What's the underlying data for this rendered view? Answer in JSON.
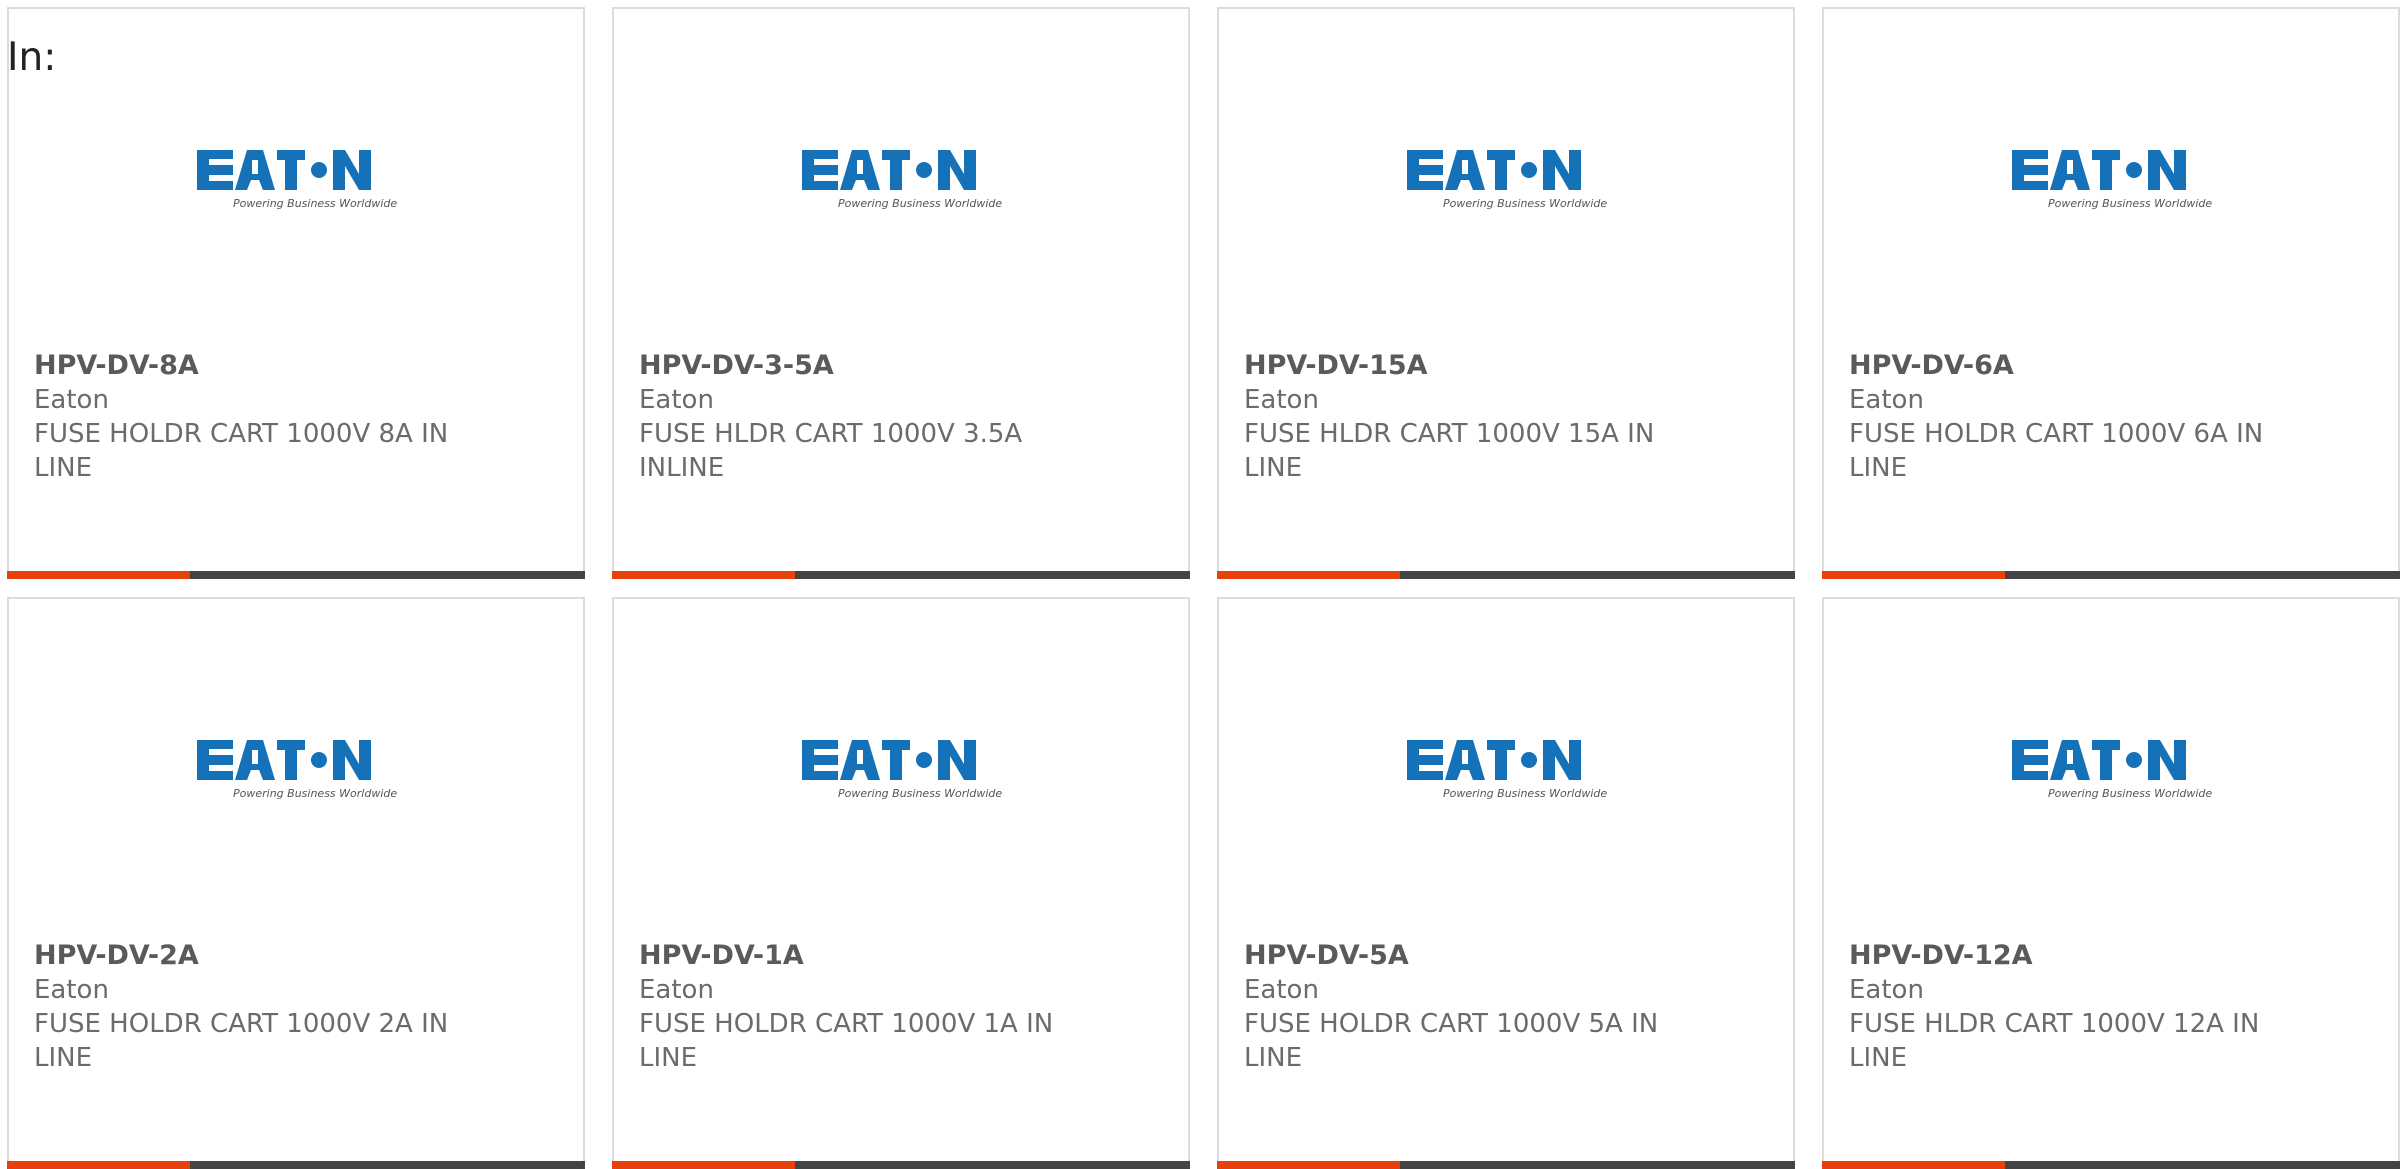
{
  "heading": "In:",
  "colors": {
    "accent": "#e8400c",
    "bar": "#444444",
    "brand_blue": "#1572b8",
    "text": "#6b6b6b"
  },
  "products": [
    {
      "part_number": "HPV-DV-8A",
      "manufacturer": "Eaton",
      "description": "FUSE HOLDR CART 1000V 8A IN LINE",
      "logo_text": "EATON",
      "logo_tagline": "Powering Business Worldwide"
    },
    {
      "part_number": "HPV-DV-3-5A",
      "manufacturer": "Eaton",
      "description": "FUSE HLDR CART 1000V 3.5A INLINE",
      "logo_text": "EATON",
      "logo_tagline": "Powering Business Worldwide"
    },
    {
      "part_number": "HPV-DV-15A",
      "manufacturer": "Eaton",
      "description": "FUSE HLDR CART 1000V 15A IN LINE",
      "logo_text": "EATON",
      "logo_tagline": "Powering Business Worldwide"
    },
    {
      "part_number": "HPV-DV-6A",
      "manufacturer": "Eaton",
      "description": "FUSE HOLDR CART 1000V 6A IN LINE",
      "logo_text": "EATON",
      "logo_tagline": "Powering Business Worldwide"
    },
    {
      "part_number": "HPV-DV-2A",
      "manufacturer": "Eaton",
      "description": "FUSE HOLDR CART 1000V 2A IN LINE",
      "logo_text": "EATON",
      "logo_tagline": "Powering Business Worldwide"
    },
    {
      "part_number": "HPV-DV-1A",
      "manufacturer": "Eaton",
      "description": "FUSE HOLDR CART 1000V 1A IN LINE",
      "logo_text": "EATON",
      "logo_tagline": "Powering Business Worldwide"
    },
    {
      "part_number": "HPV-DV-5A",
      "manufacturer": "Eaton",
      "description": "FUSE HOLDR CART 1000V 5A IN LINE",
      "logo_text": "EATON",
      "logo_tagline": "Powering Business Worldwide"
    },
    {
      "part_number": "HPV-DV-12A",
      "manufacturer": "Eaton",
      "description": "FUSE HLDR CART 1000V 12A IN LINE",
      "logo_text": "EATON",
      "logo_tagline": "Powering Business Worldwide"
    }
  ]
}
